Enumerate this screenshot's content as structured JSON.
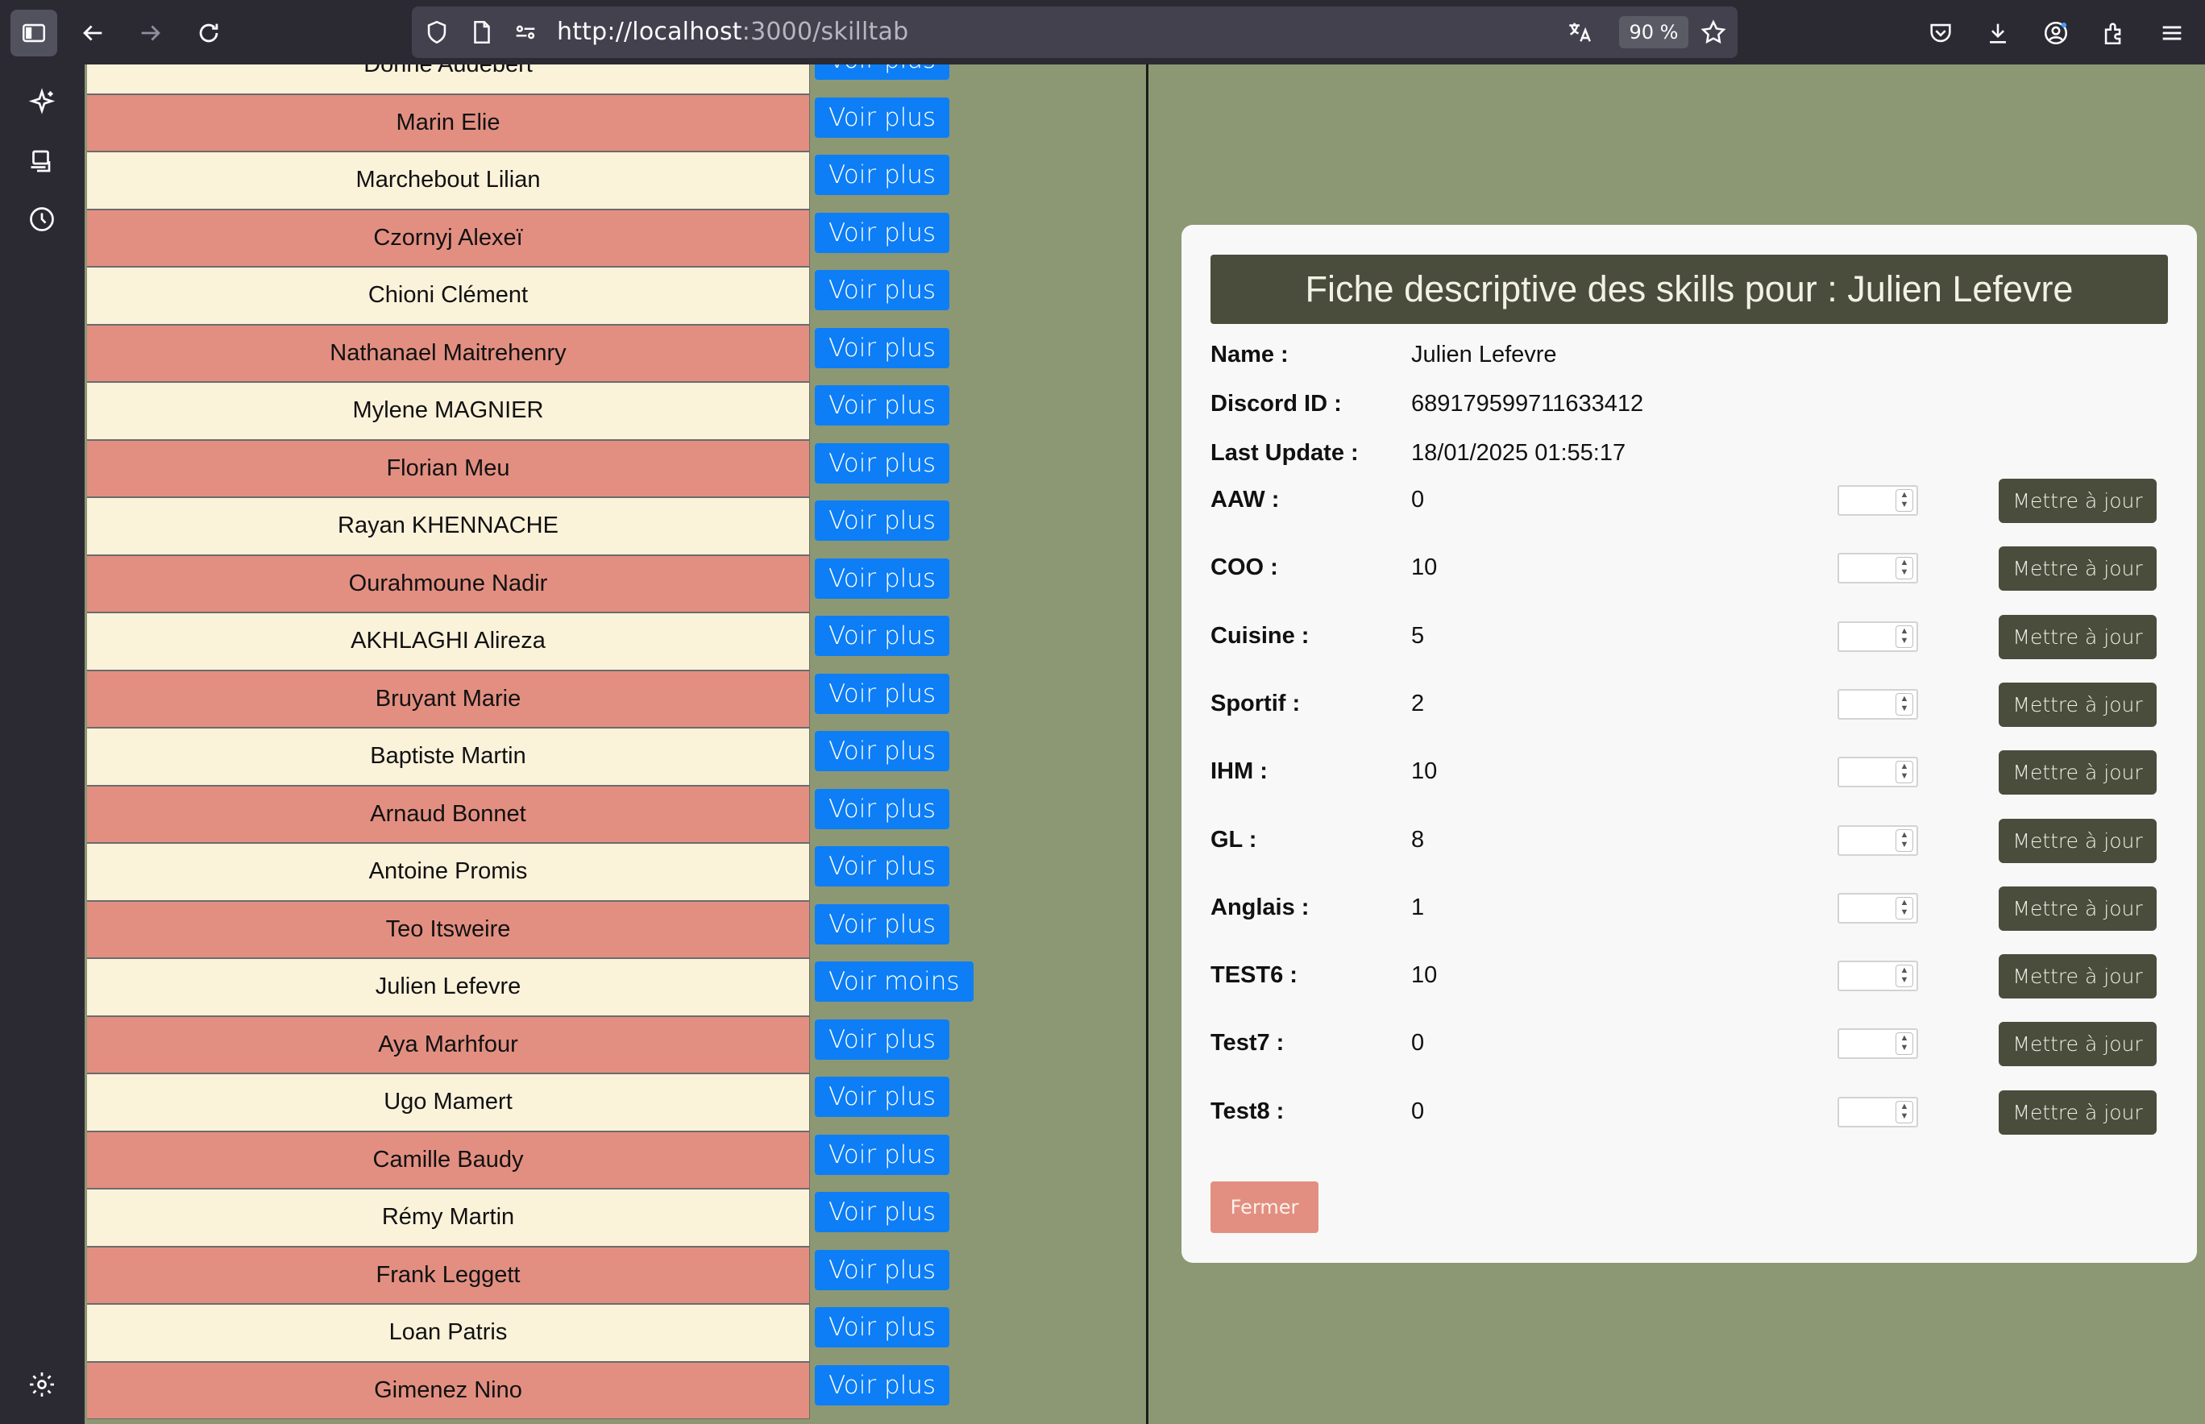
{
  "browser": {
    "url_host": "http://localhost",
    "url_rest": ":3000/skilltab",
    "zoom": "90 %"
  },
  "students": [
    {
      "name": "Dorine Audebert",
      "button": "Voir plus"
    },
    {
      "name": "Marin Elie",
      "button": "Voir plus"
    },
    {
      "name": "Marchebout Lilian",
      "button": "Voir plus"
    },
    {
      "name": "Czornyj Alexeï",
      "button": "Voir plus"
    },
    {
      "name": "Chioni Clément",
      "button": "Voir plus"
    },
    {
      "name": "Nathanael Maitrehenry",
      "button": "Voir plus"
    },
    {
      "name": "Mylene MAGNIER",
      "button": "Voir plus"
    },
    {
      "name": "Florian Meu",
      "button": "Voir plus"
    },
    {
      "name": "Rayan KHENNACHE",
      "button": "Voir plus"
    },
    {
      "name": "Ourahmoune Nadir",
      "button": "Voir plus"
    },
    {
      "name": "AKHLAGHI Alireza",
      "button": "Voir plus"
    },
    {
      "name": "Bruyant Marie",
      "button": "Voir plus"
    },
    {
      "name": "Baptiste Martin",
      "button": "Voir plus"
    },
    {
      "name": "Arnaud Bonnet",
      "button": "Voir plus"
    },
    {
      "name": "Antoine Promis",
      "button": "Voir plus"
    },
    {
      "name": "Teo Itsweire",
      "button": "Voir plus"
    },
    {
      "name": "Julien Lefevre",
      "button": "Voir moins"
    },
    {
      "name": "Aya Marhfour",
      "button": "Voir plus"
    },
    {
      "name": "Ugo Mamert",
      "button": "Voir plus"
    },
    {
      "name": "Camille Baudy",
      "button": "Voir plus"
    },
    {
      "name": "Rémy Martin",
      "button": "Voir plus"
    },
    {
      "name": "Frank Leggett",
      "button": "Voir plus"
    },
    {
      "name": "Loan Patris",
      "button": "Voir plus"
    },
    {
      "name": "Gimenez Nino",
      "button": "Voir plus"
    }
  ],
  "card": {
    "title": "Fiche descriptive des skills pour : Julien Lefevre",
    "info": [
      {
        "label": "Name :",
        "value": "Julien Lefevre"
      },
      {
        "label": "Discord ID :",
        "value": "689179599711633412"
      },
      {
        "label": "Last Update :",
        "value": "18/01/2025 01:55:17"
      }
    ],
    "skills": [
      {
        "label": "AAW :",
        "value": "0"
      },
      {
        "label": "COO :",
        "value": "10"
      },
      {
        "label": "Cuisine :",
        "value": "5"
      },
      {
        "label": "Sportif :",
        "value": "2"
      },
      {
        "label": "IHM :",
        "value": "10"
      },
      {
        "label": "GL :",
        "value": "8"
      },
      {
        "label": "Anglais :",
        "value": "1"
      },
      {
        "label": "TEST6 :",
        "value": "10"
      },
      {
        "label": "Test7 :",
        "value": "0"
      },
      {
        "label": "Test8 :",
        "value": "0"
      }
    ],
    "update_label": "Mettre à jour",
    "close_label": "Fermer"
  }
}
